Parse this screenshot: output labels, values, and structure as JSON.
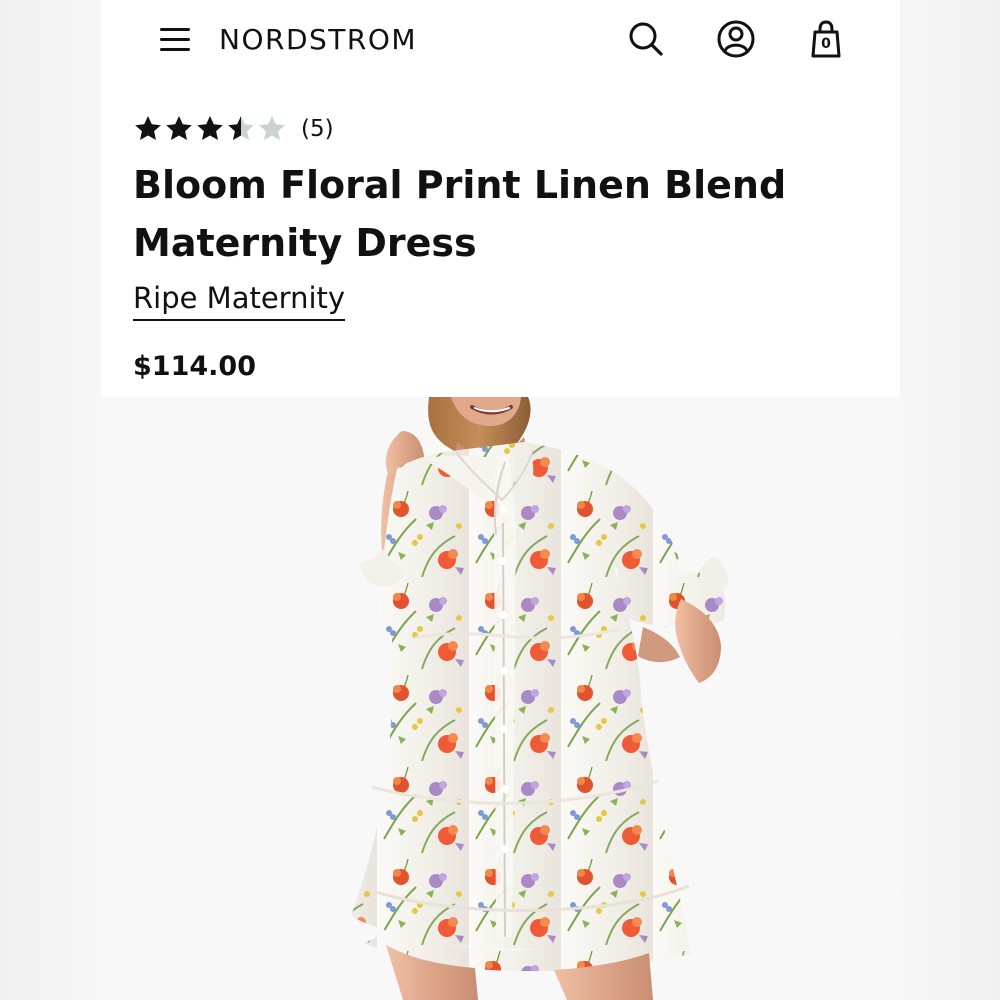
{
  "header": {
    "menu_icon": "menu-icon",
    "brand": "NORDSTROM",
    "search_icon": "search-icon",
    "account_icon": "account-icon",
    "bag_icon": "shopping-bag-icon",
    "bag_count": "0"
  },
  "product": {
    "rating_value": 3.5,
    "rating_max": 5,
    "review_count": "(5)",
    "title": "Bloom Floral Print Linen Blend Maternity Dress",
    "brand": "Ripe Maternity",
    "price": "$114.00"
  },
  "colors": {
    "text": "#111111",
    "star_filled": "#111111",
    "star_empty": "#c9d4d2",
    "page_background": "#f8f8f8",
    "card_background": "#ffffff",
    "dress_base": "#f4f1eb",
    "poppy": "#e2522f",
    "lavender": "#a98ac6",
    "mustard": "#e5c746",
    "leaf": "#7ca54d"
  }
}
